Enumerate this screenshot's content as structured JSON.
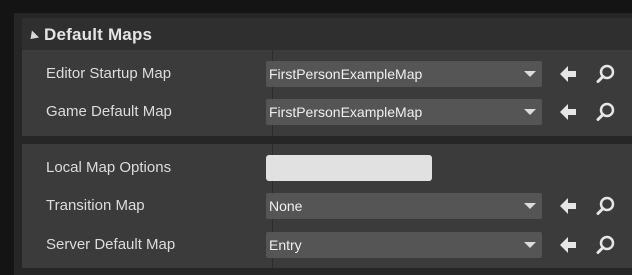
{
  "section": {
    "title": "Default Maps"
  },
  "rows": [
    {
      "label": "Editor Startup Map",
      "value": "FirstPersonExampleMap"
    },
    {
      "label": "Game Default Map",
      "value": "FirstPersonExampleMap"
    },
    {
      "label": "Local Map Options",
      "value": ""
    },
    {
      "label": "Transition Map",
      "value": "None"
    },
    {
      "label": "Server Default Map",
      "value": "Entry"
    }
  ],
  "icons": {
    "use": "arrow-left-icon",
    "browse": "search-icon",
    "expand": "collapse-arrow-icon",
    "dropdown": "chevron-down-icon"
  }
}
